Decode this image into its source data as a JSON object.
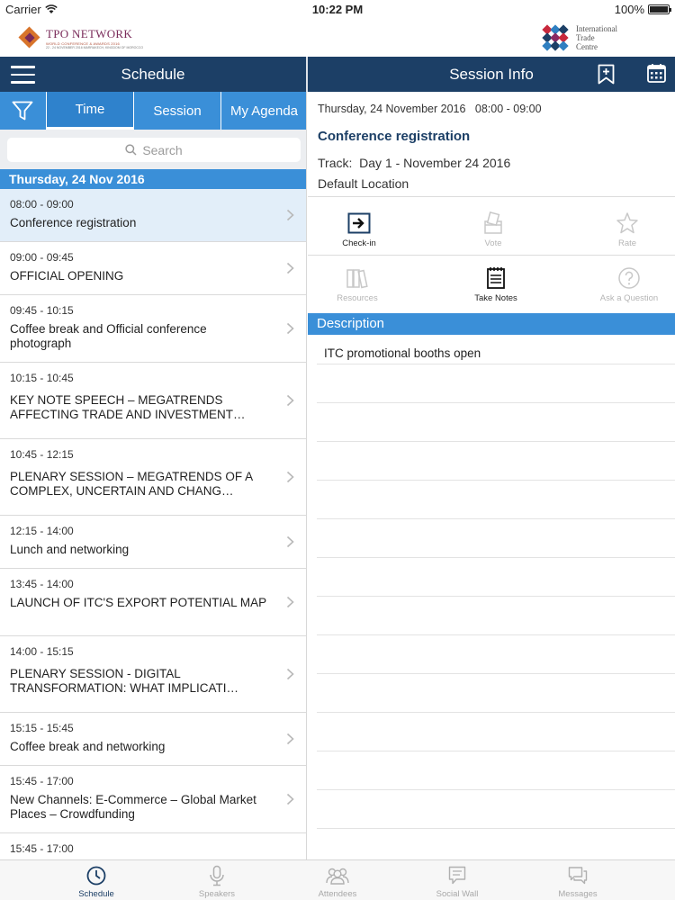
{
  "status_bar": {
    "carrier": "Carrier",
    "time": "10:22 PM",
    "battery": "100%"
  },
  "banner": {
    "left_logo": {
      "title": "TPO NETWORK",
      "line2": "WORLD CONFERENCE & AWARDS 2016",
      "line3": "22 - 24 NOVEMBER 2016  MARRAKECH, KINGDOM OF MOROCCO"
    },
    "right_logo": {
      "line1": "International",
      "line2": "Trade",
      "line3": "Centre"
    }
  },
  "header": {
    "left_title": "Schedule",
    "right_title": "Session Info"
  },
  "icons": {
    "menu": "hamburger-icon",
    "bookmark": "bookmark-add-icon",
    "calendar": "calendar-icon",
    "filter": "filter-icon",
    "search": "search-icon",
    "chevron": "chevron-right-icon"
  },
  "schedule": {
    "tabs": [
      {
        "label": "Time",
        "active": true
      },
      {
        "label": "Session",
        "active": false
      },
      {
        "label": "My Agenda",
        "active": false
      }
    ],
    "search_placeholder": "Search",
    "day_header": "Thursday, 24 Nov 2016",
    "sessions": [
      {
        "time": "08:00 - 09:00",
        "title": "Conference registration"
      },
      {
        "time": "09:00 - 09:45",
        "title": "OFFICIAL OPENING"
      },
      {
        "time": "09:45 - 10:15",
        "title": "Coffee break and Official conference photograph"
      },
      {
        "time": "10:15 - 10:45",
        "title": "KEY NOTE SPEECH – MEGATRENDS AFFECTING TRADE AND INVESTMENT…"
      },
      {
        "time": "10:45 - 12:15",
        "title": "PLENARY SESSION – MEGATRENDS OF A COMPLEX, UNCERTAIN AND CHANG…"
      },
      {
        "time": "12:15 - 14:00",
        "title": "Lunch and networking"
      },
      {
        "time": "13:45 - 14:00",
        "title": "LAUNCH OF ITC'S EXPORT POTENTIAL MAP"
      },
      {
        "time": "14:00 - 15:15",
        "title": "PLENARY SESSION - DIGITAL TRANSFORMATION: WHAT IMPLICATI…"
      },
      {
        "time": "15:15 - 15:45",
        "title": "Coffee break and networking"
      },
      {
        "time": "15:45 - 17:00",
        "title": "New Channels: E-Commerce – Global Market Places – Crowdfunding"
      },
      {
        "time": "15:45 - 17:00",
        "title": ""
      }
    ]
  },
  "session_info": {
    "date": "Thursday, 24 November 2016",
    "time": "08:00 - 09:00",
    "title": "Conference registration",
    "track_label": "Track:",
    "track_value": "Day 1 - November 24 2016",
    "location": "Default Location",
    "actions": [
      {
        "label": "Check-in",
        "icon": "check-in-icon",
        "enabled": true
      },
      {
        "label": "Vote",
        "icon": "vote-icon",
        "enabled": false
      },
      {
        "label": "Rate",
        "icon": "star-icon",
        "enabled": false
      },
      {
        "label": "Resources",
        "icon": "books-icon",
        "enabled": false
      },
      {
        "label": "Take Notes",
        "icon": "notepad-icon",
        "enabled": true
      },
      {
        "label": "Ask a Question",
        "icon": "question-icon",
        "enabled": false
      }
    ],
    "description_header": "Description",
    "description": "ITC promotional booths open"
  },
  "tab_bar": [
    {
      "label": "Schedule",
      "icon": "clock-icon",
      "active": true
    },
    {
      "label": "Speakers",
      "icon": "microphone-icon",
      "active": false
    },
    {
      "label": "Attendees",
      "icon": "people-icon",
      "active": false
    },
    {
      "label": "Social Wall",
      "icon": "social-wall-icon",
      "active": false
    },
    {
      "label": "Messages",
      "icon": "messages-icon",
      "active": false
    }
  ],
  "colors": {
    "nav_dark": "#1c3f66",
    "accent_blue": "#3a8fd8",
    "selected_row": "#e2eef9",
    "disabled_gray": "#b5b5b5"
  }
}
